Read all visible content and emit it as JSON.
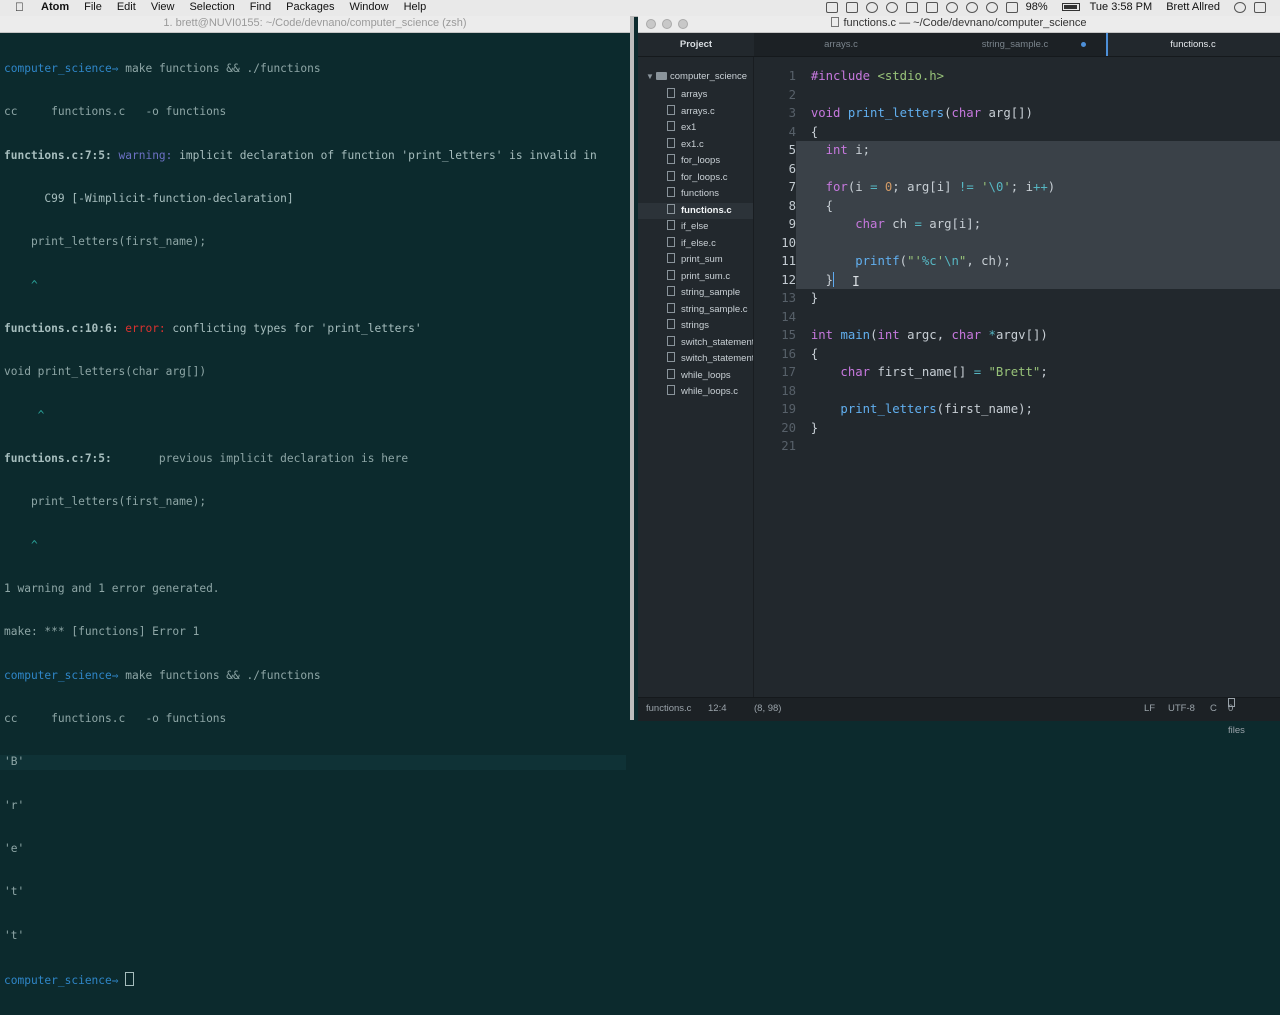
{
  "menubar": {
    "app": "Atom",
    "menus": [
      "File",
      "Edit",
      "View",
      "Selection",
      "Find",
      "Packages",
      "Window",
      "Help"
    ],
    "battery": "98%",
    "clock": "Tue 3:58 PM",
    "user": "Brett Allred"
  },
  "terminal": {
    "title": "1. brett@NUVI0155: ~/Code/devnano/computer_science (zsh)",
    "prompt": "computer_science",
    "arrow": "⇒",
    "lines": {
      "l1_cmd": " make functions && ./functions",
      "l2": "cc     functions.c   -o functions",
      "l3_file": "functions.c:7:5:",
      "l3_warn": " warning:",
      "l3_msg": " implicit declaration of function 'print_letters' is invalid in",
      "l4": "      C99 [-Wimplicit-function-declaration]",
      "l5": "    print_letters(first_name);",
      "l6": "    ^",
      "l7_file": "functions.c:10:6:",
      "l7_err": " error:",
      "l7_msg": " conflicting types for 'print_letters'",
      "l8": "void print_letters(char arg[])",
      "l9": "     ^",
      "l10_file": "functions.c:7:5:",
      "l10_msg": "       previous implicit declaration is here",
      "l11": "    print_letters(first_name);",
      "l12": "    ^",
      "l13": "1 warning and 1 error generated.",
      "l14": "make: *** [functions] Error 1",
      "l15_cmd": " make functions && ./functions",
      "l16": "cc     functions.c   -o functions",
      "out1": "'B'",
      "out2": "'r'",
      "out3": "'e'",
      "out4": "'t'",
      "out5": "'t'"
    }
  },
  "atom": {
    "title": "functions.c — ~/Code/devnano/computer_science",
    "tabs": {
      "project": "Project",
      "t1": "arrays.c",
      "t2": "string_sample.c",
      "t3": "functions.c"
    },
    "tree_root": "computer_science",
    "tree_items": [
      "arrays",
      "arrays.c",
      "ex1",
      "ex1.c",
      "for_loops",
      "for_loops.c",
      "functions",
      "functions.c",
      "if_else",
      "if_else.c",
      "print_sum",
      "print_sum.c",
      "string_sample",
      "string_sample.c",
      "strings",
      "switch_statement",
      "switch_statement.c",
      "while_loops",
      "while_loops.c"
    ],
    "line_numbers": [
      "1",
      "2",
      "3",
      "4",
      "5",
      "6",
      "7",
      "8",
      "9",
      "10",
      "11",
      "12",
      "13",
      "14",
      "15",
      "16",
      "17",
      "18",
      "19",
      "20",
      "21"
    ],
    "status": {
      "file": "functions.c",
      "cursor": "12:4",
      "selection": "(8, 98)",
      "eol": "LF",
      "encoding": "UTF-8",
      "grammar": "C",
      "files": "0 files"
    }
  }
}
